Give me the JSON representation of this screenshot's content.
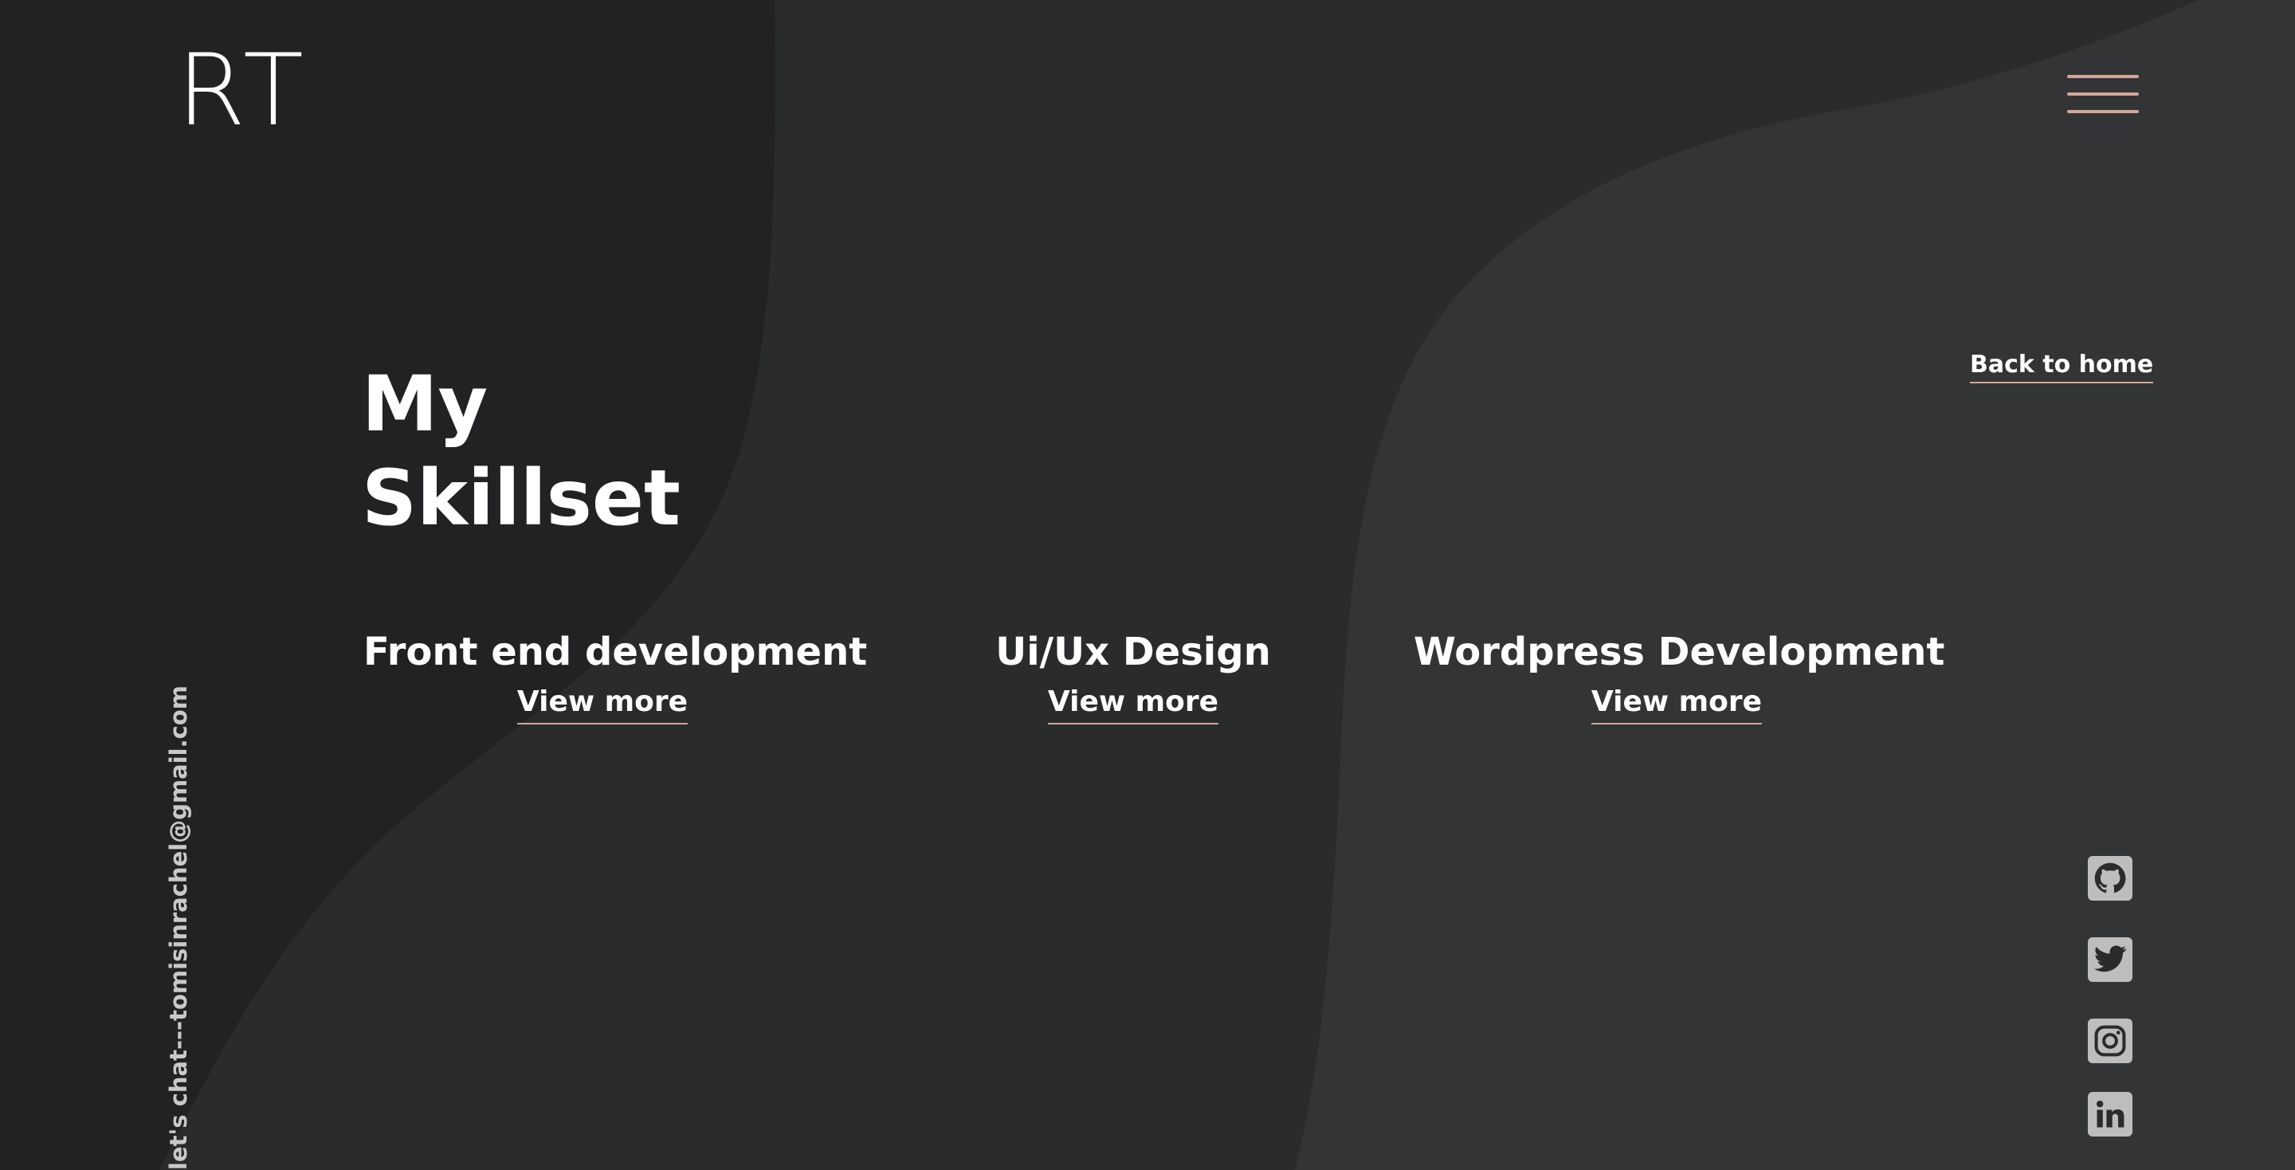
{
  "theme": {
    "accent": "#d4a698",
    "background_dark": "#222224",
    "background_mid": "#2a2b2d",
    "background_light": "#333436"
  },
  "header": {
    "logo_text": "RT",
    "menu_icon": "hamburger-menu-icon"
  },
  "nav": {
    "back_home_label": "Back to home"
  },
  "main": {
    "title_line1": "My",
    "title_line2": "Skillset",
    "skills": [
      {
        "title": "Front end development",
        "link_label": "View more"
      },
      {
        "title": "Ui/Ux Design",
        "link_label": "View more"
      },
      {
        "title": "Wordpress Development",
        "link_label": "View more"
      }
    ]
  },
  "contact": {
    "email_text": "let's chat---tomisinrachel@gmail.com"
  },
  "social": [
    {
      "icon": "github-icon"
    },
    {
      "icon": "twitter-icon"
    },
    {
      "icon": "instagram-icon"
    },
    {
      "icon": "linkedin-icon"
    }
  ]
}
